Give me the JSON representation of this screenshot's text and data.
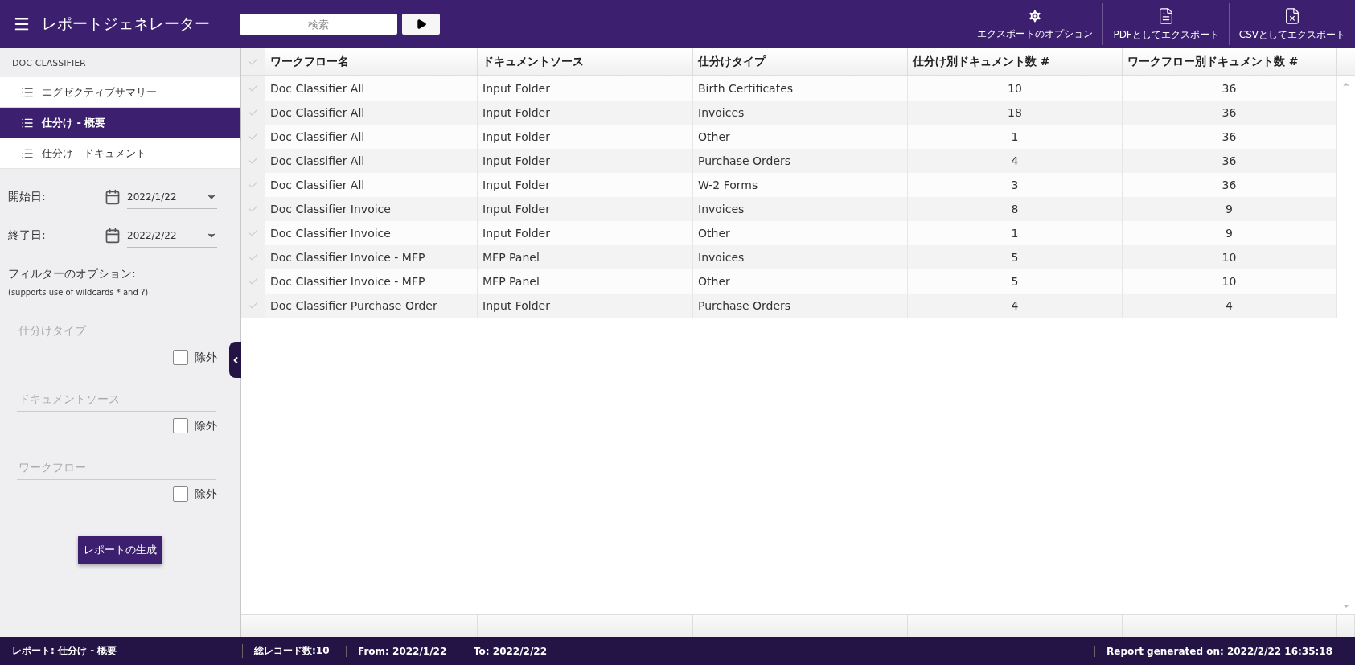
{
  "header": {
    "title": "レポートジェネレーター",
    "search": {
      "placeholder": "検索"
    },
    "actions": [
      {
        "kind": "options",
        "label": "エクスポートのオプション"
      },
      {
        "kind": "pdf",
        "label": "PDFとしてエクスポート"
      },
      {
        "kind": "csv",
        "label": "CSVとしてエクスポート"
      }
    ]
  },
  "sidebar": {
    "section": "DOC-CLASSIFIER",
    "items": [
      {
        "label": "エグゼクティブサマリー",
        "selected": false
      },
      {
        "label": "仕分け - 概要",
        "selected": true
      },
      {
        "label": "仕分け - ドキュメント",
        "selected": false
      }
    ],
    "dates": [
      {
        "label": "開始日:",
        "value": "2022/1/22"
      },
      {
        "label": "終了日:",
        "value": "2022/2/22"
      }
    ],
    "filter_title": "フィルターのオプション:",
    "filter_hint": "(supports use of wildcards * and ?)",
    "filters": [
      {
        "placeholder": "仕分けタイプ",
        "exclude_label": "除外",
        "checked": false
      },
      {
        "placeholder": "ドキュメントソース",
        "exclude_label": "除外",
        "checked": false
      },
      {
        "placeholder": "ワークフロー",
        "exclude_label": "除外",
        "checked": false
      }
    ],
    "generate_button": "レポートの生成"
  },
  "table": {
    "columns": [
      {
        "label": "ワークフロー名",
        "kind": "text"
      },
      {
        "label": "ドキュメントソース",
        "kind": "text"
      },
      {
        "label": "仕分けタイプ",
        "kind": "text"
      },
      {
        "label": "仕分け別ドキュメント数 #",
        "kind": "number"
      },
      {
        "label": "ワークフロー別ドキュメント数 #",
        "kind": "number"
      }
    ],
    "rows": [
      {
        "selected": false,
        "cells": [
          "Doc Classifier All",
          "Input Folder",
          "Birth Certificates",
          "10",
          "36"
        ]
      },
      {
        "selected": false,
        "cells": [
          "Doc Classifier All",
          "Input Folder",
          "Invoices",
          "18",
          "36"
        ]
      },
      {
        "selected": false,
        "cells": [
          "Doc Classifier All",
          "Input Folder",
          "Other",
          "1",
          "36"
        ]
      },
      {
        "selected": false,
        "cells": [
          "Doc Classifier All",
          "Input Folder",
          "Purchase Orders",
          "4",
          "36"
        ]
      },
      {
        "selected": false,
        "cells": [
          "Doc Classifier All",
          "Input Folder",
          "W-2 Forms",
          "3",
          "36"
        ]
      },
      {
        "selected": false,
        "cells": [
          "Doc Classifier Invoice",
          "Input Folder",
          "Invoices",
          "8",
          "9"
        ]
      },
      {
        "selected": false,
        "cells": [
          "Doc Classifier Invoice",
          "Input Folder",
          "Other",
          "1",
          "9"
        ]
      },
      {
        "selected": false,
        "cells": [
          "Doc Classifier Invoice - MFP",
          "MFP Panel",
          "Invoices",
          "5",
          "10"
        ]
      },
      {
        "selected": false,
        "cells": [
          "Doc Classifier Invoice - MFP",
          "MFP Panel",
          "Other",
          "5",
          "10"
        ]
      },
      {
        "selected": false,
        "cells": [
          "Doc Classifier Purchase Order",
          "Input Folder",
          "Purchase Orders",
          "4",
          "4"
        ]
      }
    ]
  },
  "status_bar": {
    "report": "レポート: 仕分け - 概要",
    "total": "総レコード数:10",
    "from": "From: 2022/1/22",
    "to": "To: 2022/2/22",
    "generated": "Report generated on: 2022/2/22 16:35:18"
  }
}
